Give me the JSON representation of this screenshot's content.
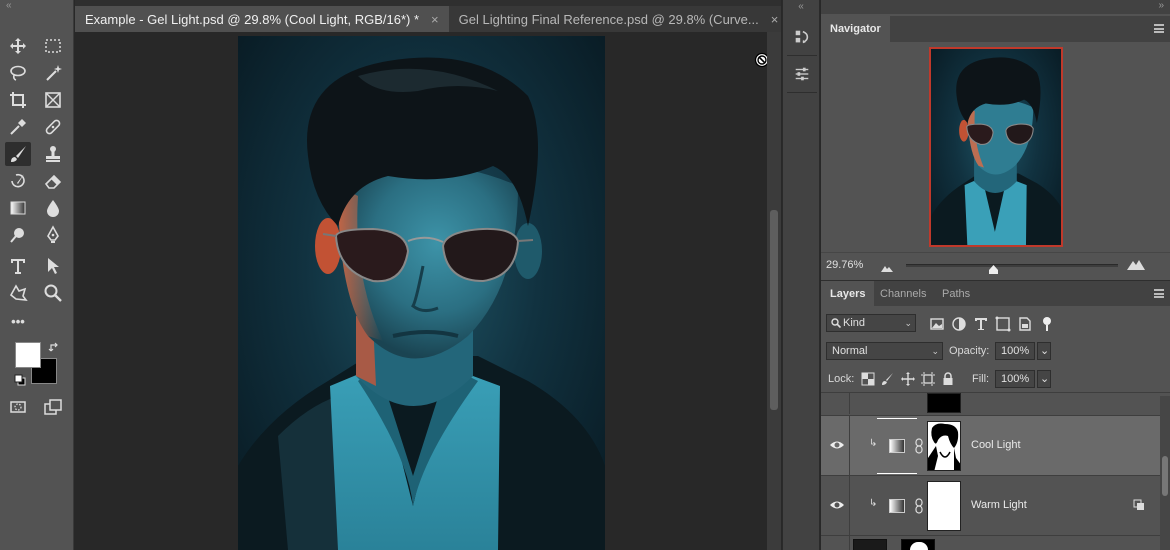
{
  "document_tabs": [
    {
      "label": "Example - Gel Light.psd @ 29.8% (Cool Light, RGB/16*) *",
      "close": "×"
    },
    {
      "label": "Gel Lighting Final Reference.psd @ 29.8% (Curve...",
      "close": "×"
    }
  ],
  "toolbar": {
    "collapse": "«",
    "tools": [
      "move-tool",
      "artboard-tool",
      "lasso-tool",
      "magic-wand-tool",
      "crop-tool",
      "frame-tool",
      "eyedropper-tool",
      "healing-brush-tool",
      "brush-tool",
      "clone-stamp-tool",
      "history-brush-tool",
      "eraser-tool",
      "gradient-tool",
      "blur-tool",
      "dodge-tool",
      "pen-tool",
      "type-tool",
      "path-selection-tool",
      "shape-tool",
      "zoom-tool",
      "more-tools",
      "quick-mask",
      "screen-mode"
    ],
    "active_tool": "brush-tool",
    "more_label": "•••",
    "foreground_color": "#ffffff",
    "background_color": "#000000"
  },
  "icon_strip": {
    "collapse": "«",
    "buttons": [
      "history-icon",
      "adjustments-icon"
    ]
  },
  "panels": {
    "collapse": "»",
    "navigator": {
      "tab": "Navigator",
      "zoom": "29.76%",
      "zoom_slider_value": 0.41,
      "view_box_color": "#c0392b"
    },
    "layers_tabs": [
      "Layers",
      "Channels",
      "Paths"
    ],
    "layers": {
      "filter_kind": "Kind",
      "filter_kind_icon": "search-icon",
      "blend_mode": "Normal",
      "opacity_label": "Opacity:",
      "opacity_value": "100%",
      "lock_label": "Lock:",
      "fill_label": "Fill:",
      "fill_value": "100%",
      "items": [
        {
          "name": "Cool Light",
          "visible": true,
          "selected": true,
          "clipped": true
        },
        {
          "name": "Warm Light",
          "visible": true,
          "selected": false,
          "clipped": true
        }
      ]
    }
  },
  "colors": {
    "accent_bg": "#535353",
    "canvas_bg": "#282828",
    "photo_teal": "#1f5566",
    "rim_light_orange": "#d9603a"
  }
}
